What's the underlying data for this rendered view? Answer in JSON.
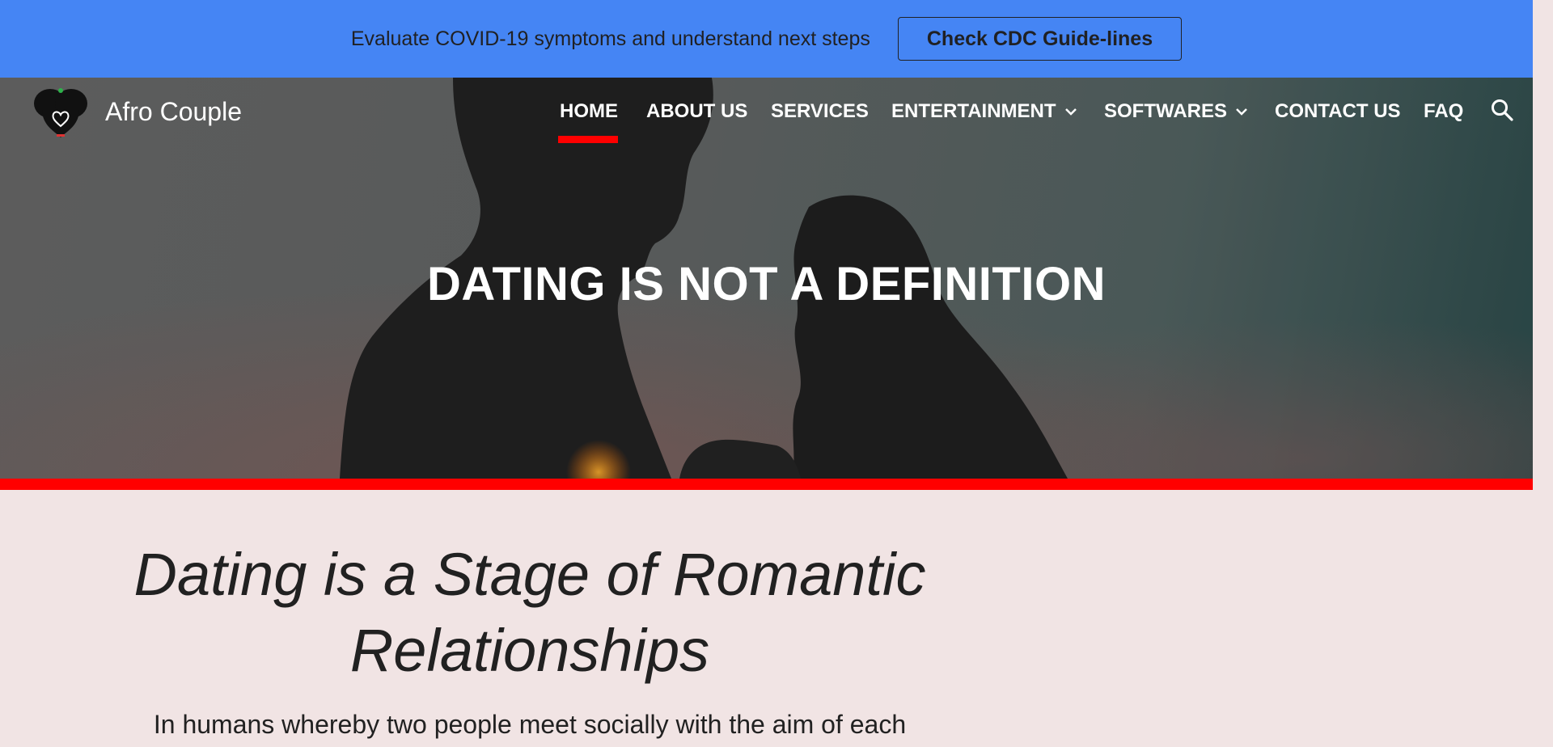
{
  "banner": {
    "text": "Evaluate COVID-19 symptoms and understand next steps",
    "button_label": "Check CDC Guide-lines"
  },
  "header": {
    "site_title": "Afro Couple",
    "logo_icon": "couple-heart-logo-icon",
    "nav": [
      {
        "label": "HOME",
        "active": true
      },
      {
        "label": "ABOUT US"
      },
      {
        "label": "SERVICES"
      },
      {
        "label": "ENTERTAINMENT",
        "dropdown": true
      },
      {
        "label": "SOFTWARES",
        "dropdown": true
      },
      {
        "label": "CONTACT US"
      },
      {
        "label": "FAQ"
      }
    ],
    "search_icon": "search-icon"
  },
  "hero": {
    "title": "DATING IS NOT A DEFINITION"
  },
  "content": {
    "heading": "Dating is a Stage of Romantic Relationships",
    "body": "In humans whereby two people meet socially with the aim of each"
  },
  "colors": {
    "banner_bg": "#4585f4",
    "accent_red": "#ff0000",
    "page_bg": "#f1e4e4",
    "text_dark": "#212121"
  }
}
